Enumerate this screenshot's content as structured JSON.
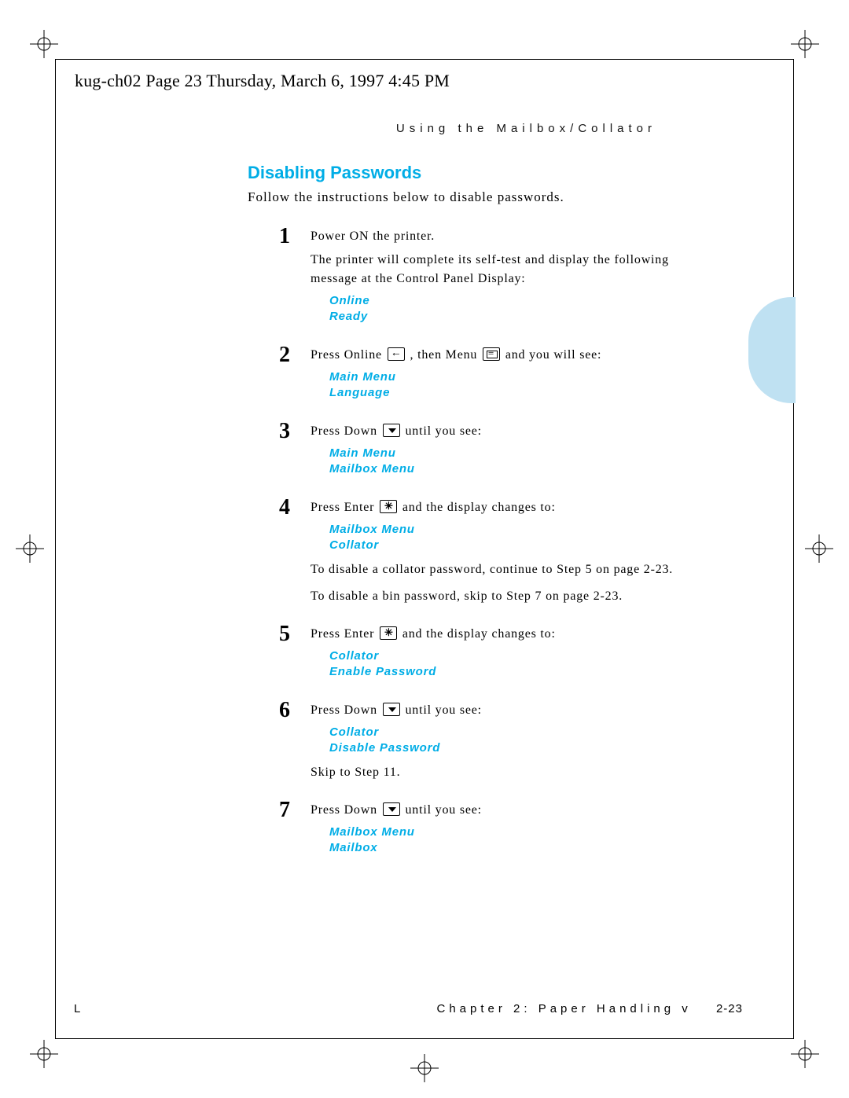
{
  "file_stamp": "kug-ch02  Page 23  Thursday, March 6, 1997  4:45 PM",
  "running_head": "Using the Mailbox/Collator",
  "section_title": "Disabling Passwords",
  "intro": "Follow the instructions below to disable passwords.",
  "steps": {
    "1": {
      "line1": "Power ON the printer.",
      "line2": "The printer will complete its self-test and display the following message at the Control Panel Display:",
      "lcd1": "Online",
      "lcd2": "Ready"
    },
    "2": {
      "pre": "Press Online ",
      "mid": " , then Menu ",
      "post": " and you will see:",
      "lcd1": "Main Menu",
      "lcd2": "Language"
    },
    "3": {
      "pre": "Press Down ",
      "post": " until you see:",
      "lcd1": "Main Menu",
      "lcd2": "Mailbox Menu"
    },
    "4": {
      "pre": "Press Enter ",
      "post": " and the display changes to:",
      "lcd1": "Mailbox Menu",
      "lcd2": "Collator",
      "note1": "To disable a collator password, continue to Step 5 on page 2-23.",
      "note2": "To disable a bin password, skip to Step 7 on page 2-23."
    },
    "5": {
      "pre": "Press Enter ",
      "post": " and the display changes to:",
      "lcd1": "Collator",
      "lcd2": "Enable Password"
    },
    "6": {
      "pre": "Press Down ",
      "post": " until you see:",
      "lcd1": "Collator",
      "lcd2": "Disable Password",
      "note": "Skip to Step 11."
    },
    "7": {
      "pre": "Press Down ",
      "post": " until you see:",
      "lcd1": "Mailbox Menu",
      "lcd2": "Mailbox"
    }
  },
  "footer": {
    "chapter": "Chapter 2: Paper Handling",
    "arrow": "v",
    "page": "2-23"
  },
  "corner_mark": "L"
}
